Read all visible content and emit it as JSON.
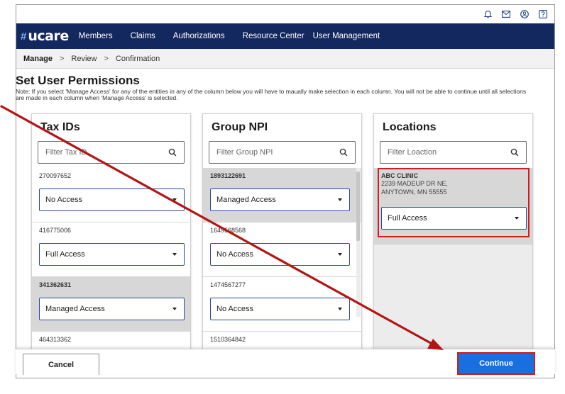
{
  "brand": {
    "logo_text": "ucare"
  },
  "utility_icons": [
    "bell-icon",
    "mail-icon",
    "account-icon",
    "help-icon"
  ],
  "nav": [
    "Members",
    "Claims",
    "Authorizations",
    "Resource Center",
    "User Management"
  ],
  "breadcrumb": {
    "step1": "Manage",
    "step2": "Review",
    "step3": "Confirmation",
    "separator": ">"
  },
  "page": {
    "title": "Set User Permissions",
    "note": "Note: If you select 'Manage Access' for any of the entities in any of the column below you will have to maually make selection in each column. You will not be able to continue until all selections are made in each column when 'Manage Access' is selected."
  },
  "tax_ids": {
    "header": "Tax IDs",
    "filter_placeholder": "Filter Tax ID",
    "items": [
      {
        "id": "270097652",
        "access": "No Access"
      },
      {
        "id": "416775006",
        "access": "Full Access"
      },
      {
        "id": "341362631",
        "access": "Managed Access"
      },
      {
        "id": "464313362",
        "access": ""
      }
    ]
  },
  "group_npi": {
    "header": "Group NPI",
    "filter_placeholder": "Filter Group NPI",
    "items": [
      {
        "id": "1893122691",
        "access": "Managed Access"
      },
      {
        "id": "1649568568",
        "access": "No Access"
      },
      {
        "id": "1474567277",
        "access": "No Access"
      },
      {
        "id": "1510364842",
        "access": ""
      }
    ]
  },
  "locations": {
    "header": "Locations",
    "filter_placeholder": "Filter Loaction",
    "items": [
      {
        "name": "ABC CLINIC",
        "address1": "2239 MADEUP DR NE,",
        "address2": "ANYTOWN, MN 55555",
        "access": "Full Access"
      }
    ]
  },
  "footer": {
    "cancel": "Cancel",
    "continue": "Continue"
  },
  "colors": {
    "navbar": "#13285f",
    "continue": "#1a6fe0",
    "annotation": "#b31414",
    "highlight": "#cc1f1f"
  }
}
